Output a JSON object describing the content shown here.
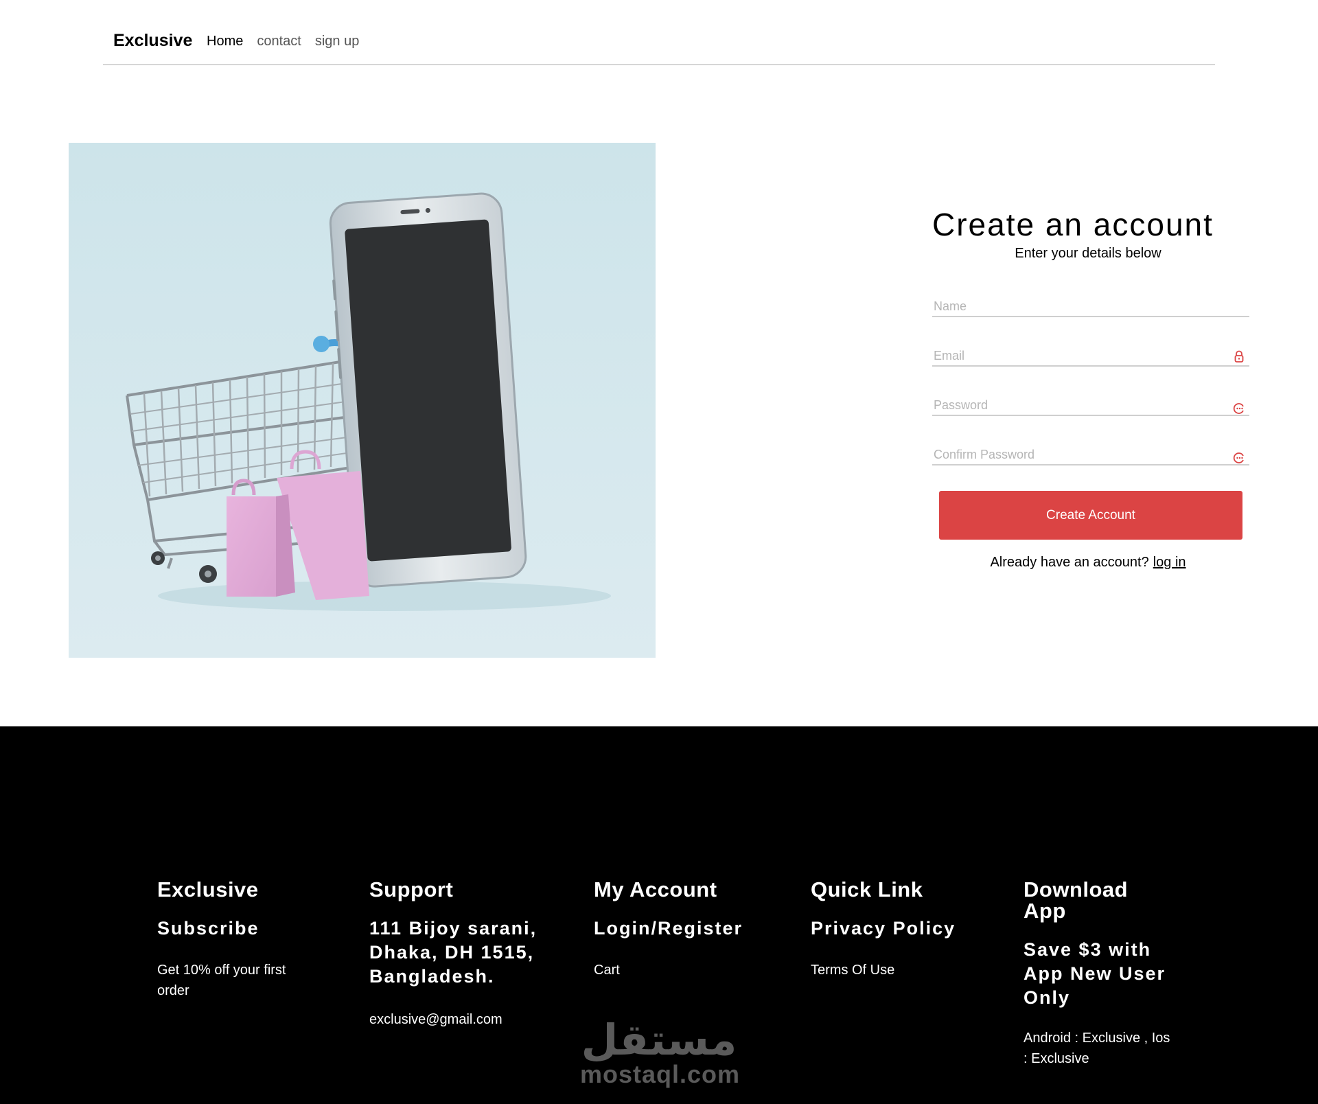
{
  "header": {
    "brand": "Exclusive",
    "nav": [
      {
        "label": "Home",
        "active": true
      },
      {
        "label": "contact",
        "active": false
      },
      {
        "label": "sign up",
        "active": false
      }
    ]
  },
  "form": {
    "title": "Create an account",
    "subtitle": "Enter your details below",
    "fields": {
      "name": {
        "placeholder": "Name",
        "value": ""
      },
      "email": {
        "placeholder": "Email",
        "value": "",
        "icon": "lock-icon"
      },
      "password": {
        "placeholder": "Password",
        "value": "",
        "icon": "password-manager-icon"
      },
      "confirm_password": {
        "placeholder": "Confirm Password",
        "value": "",
        "icon": "password-manager-icon"
      }
    },
    "submit_label": "Create Account",
    "login_prompt": "Already have an account?",
    "login_link": "log in"
  },
  "colors": {
    "accent": "#db4444",
    "footer_bg": "#000000",
    "hero_bg": "#cde4ea"
  },
  "footer": {
    "exclusive": {
      "heading": "Exclusive",
      "subheading": "Subscribe",
      "text": "Get 10% off your first order"
    },
    "support": {
      "heading": "Support",
      "address": "111 Bijoy sarani, Dhaka, DH 1515, Bangladesh.",
      "email": "exclusive@gmail.com"
    },
    "account": {
      "heading": "My Account",
      "login": "Login/Register",
      "cart": "Cart"
    },
    "quick_link": {
      "heading": "Quick Link",
      "privacy": "Privacy Policy",
      "terms": "Terms Of Use"
    },
    "download": {
      "heading": "Download App",
      "promo": "Save $3 with App New User Only",
      "stores": "Android : Exclusive , Ios : Exclusive"
    }
  },
  "watermark": {
    "text": "mostaql.com",
    "arabic": "مستقل"
  }
}
